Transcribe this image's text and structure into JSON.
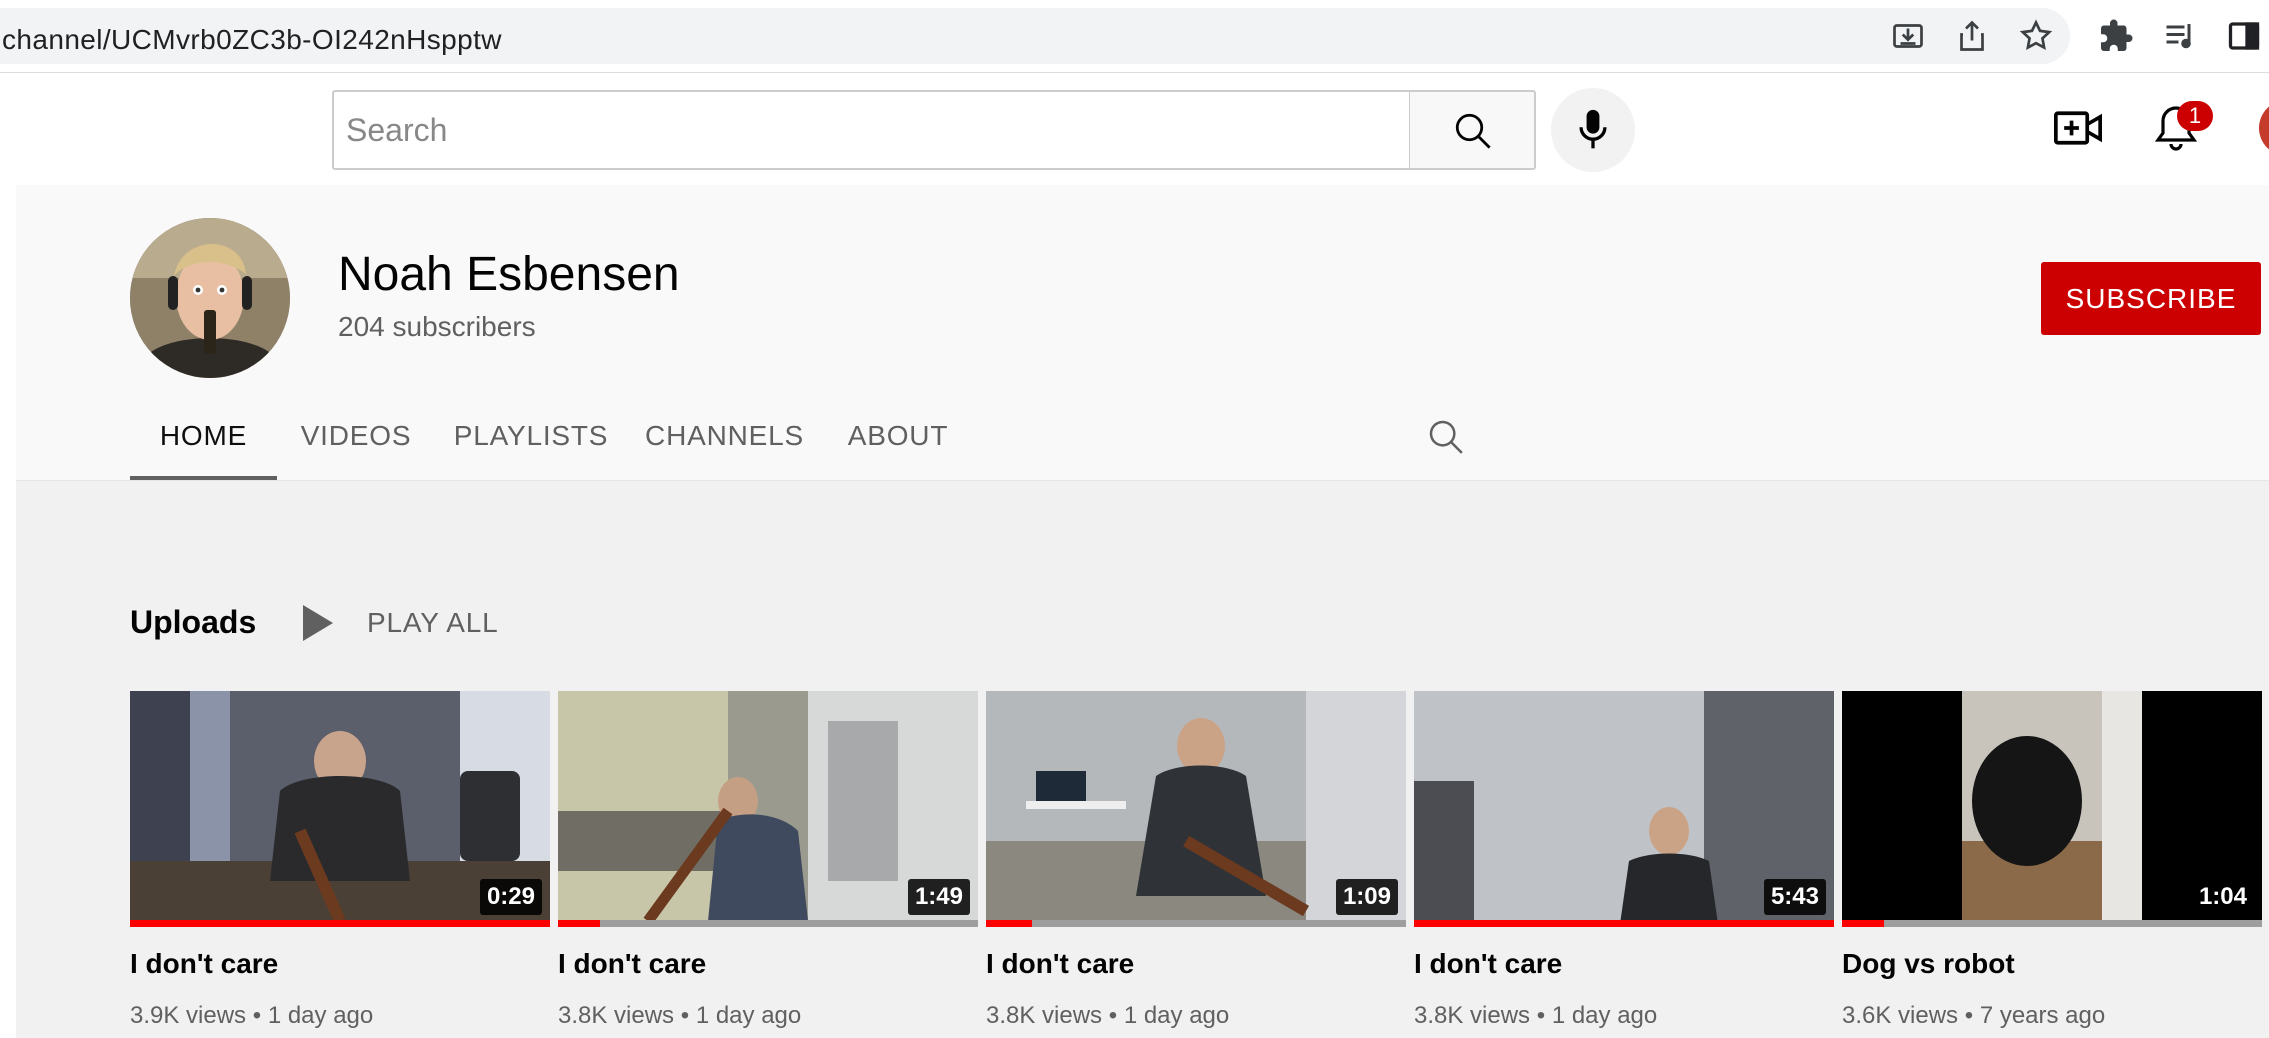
{
  "browser": {
    "url": "channel/UCMvrb0ZC3b-OI242nHspptw"
  },
  "masthead": {
    "search_placeholder": "Search",
    "notification_count": "1"
  },
  "channel": {
    "name": "Noah Esbensen",
    "subscribers": "204 subscribers",
    "subscribe_label": "SUBSCRIBE"
  },
  "tabs": [
    {
      "label": "HOME",
      "active": true
    },
    {
      "label": "VIDEOS",
      "active": false
    },
    {
      "label": "PLAYLISTS",
      "active": false
    },
    {
      "label": "CHANNELS",
      "active": false
    },
    {
      "label": "ABOUT",
      "active": false
    }
  ],
  "shelf": {
    "title": "Uploads",
    "play_all_label": "PLAY ALL"
  },
  "videos": [
    {
      "title": "I don't care",
      "views": "3.9K views",
      "age": "1 day ago",
      "duration": "0:29",
      "watched_fraction": 1.0
    },
    {
      "title": "I don't care",
      "views": "3.8K views",
      "age": "1 day ago",
      "duration": "1:49",
      "watched_fraction": 0.1
    },
    {
      "title": "I don't care",
      "views": "3.8K views",
      "age": "1 day ago",
      "duration": "1:09",
      "watched_fraction": 0.11
    },
    {
      "title": "I don't care",
      "views": "3.8K views",
      "age": "1 day ago",
      "duration": "5:43",
      "watched_fraction": 1.0
    },
    {
      "title": "Dog vs robot",
      "views": "3.6K views",
      "age": "7 years ago",
      "duration": "1:04",
      "watched_fraction": 0.1
    }
  ],
  "colors": {
    "subscribe": "#cc0000",
    "progress": "#ff0000",
    "badge": "#cc0000"
  }
}
